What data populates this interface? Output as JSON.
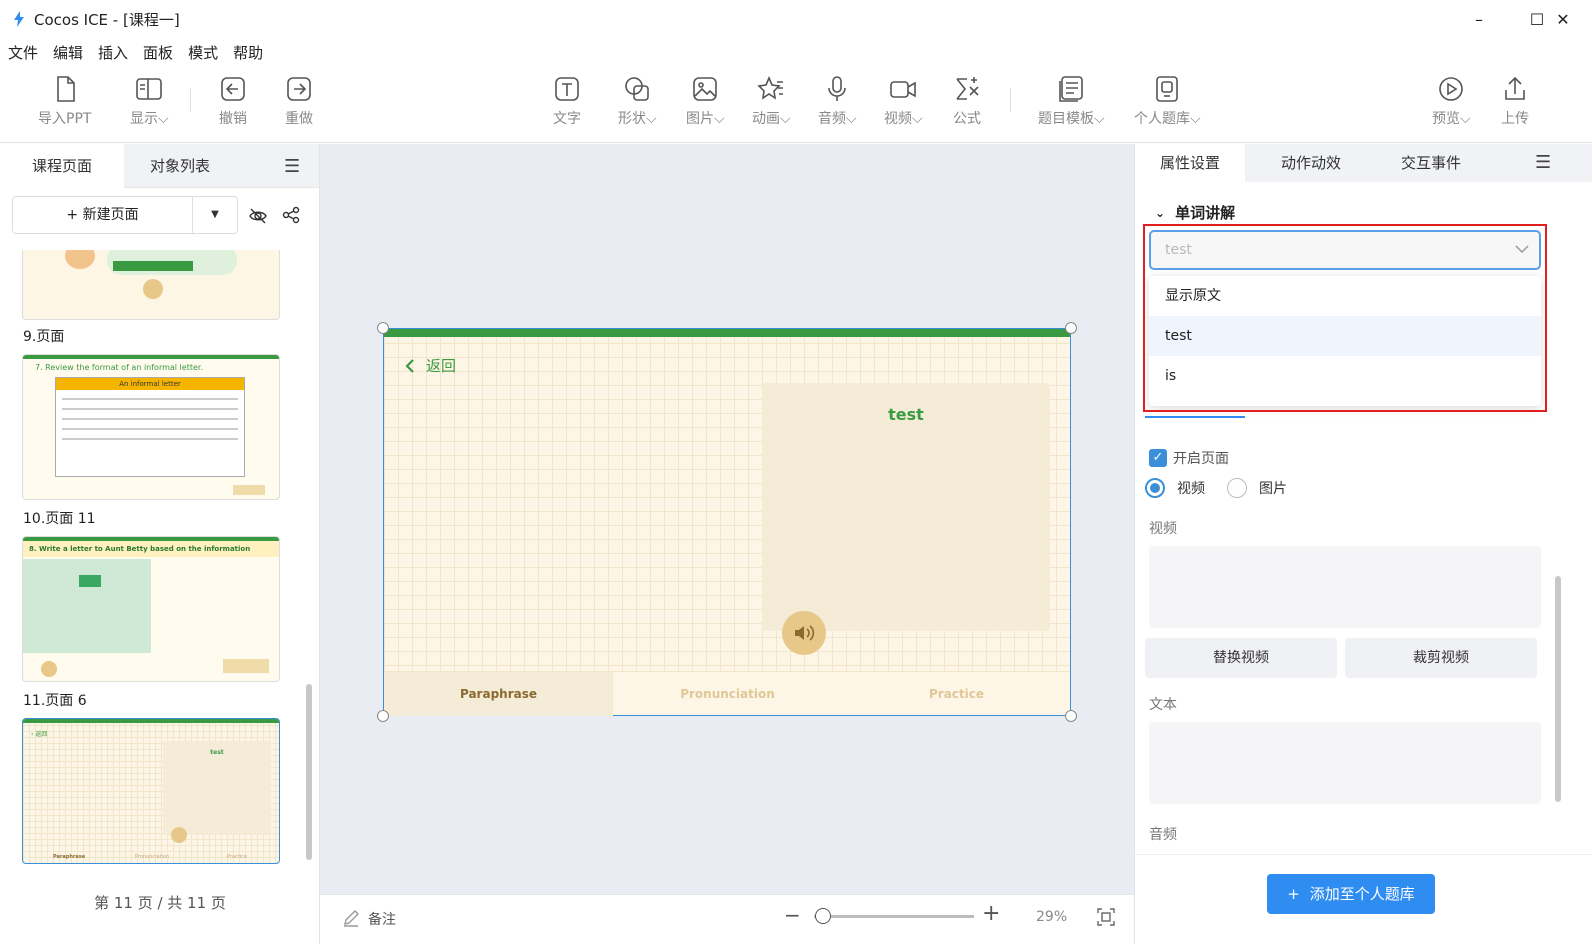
{
  "window": {
    "title": "Cocos ICE - [课程一]",
    "minimize": "–",
    "maximize": "☐",
    "close": "✕"
  },
  "menu": [
    "文件",
    "编辑",
    "插入",
    "面板",
    "模式",
    "帮助"
  ],
  "toolbar": {
    "import_ppt": "导入PPT",
    "display": "显示",
    "undo": "撤销",
    "redo": "重做",
    "text": "文字",
    "shape": "形状",
    "image": "图片",
    "animation": "动画",
    "audio": "音频",
    "video": "视频",
    "formula": "公式",
    "question_template": "题目模板",
    "personal_bank": "个人题库",
    "preview": "预览",
    "upload": "上传"
  },
  "left_panel": {
    "tabs": [
      "课程页面",
      "对象列表"
    ],
    "new_page": "+ 新建页面",
    "thumbs": [
      {
        "label": "9.页面"
      },
      {
        "label": "10.页面 11",
        "heading": "7. Review the format of an informal letter.",
        "band": "An informal letter"
      },
      {
        "label": "11.页面 6",
        "heading": "8. Write a letter to Aunt Betty based on the information"
      },
      {
        "label": "",
        "word": "test",
        "back": "返回",
        "tabs": [
          "Paraphrase",
          "Pronunciation",
          "Practice"
        ]
      }
    ],
    "page_count": "第 11 页 / 共 11 页"
  },
  "canvas": {
    "back": "返回",
    "word": "test",
    "tabs": [
      "Paraphrase",
      "Pronunciation",
      "Practice"
    ]
  },
  "statusbar": {
    "note": "备注",
    "zoom": "29%",
    "zoom_level": 0.29
  },
  "right_panel": {
    "tabs": [
      "属性设置",
      "动作动效",
      "交互事件"
    ],
    "section": "单词讲解",
    "select_value": "test",
    "options": [
      "显示原文",
      "test",
      "is"
    ],
    "selected_option": "test",
    "open_page": "开启页面",
    "radio_video": "视频",
    "radio_image": "图片",
    "video_label": "视频",
    "replace_video": "替换视频",
    "crop_video": "裁剪视频",
    "text_label": "文本",
    "audio_label": "音频",
    "add_button": "添加至个人题库"
  },
  "colors": {
    "accent": "#2f8cf0",
    "green": "#3a9a42",
    "highlight": "#e02020"
  }
}
